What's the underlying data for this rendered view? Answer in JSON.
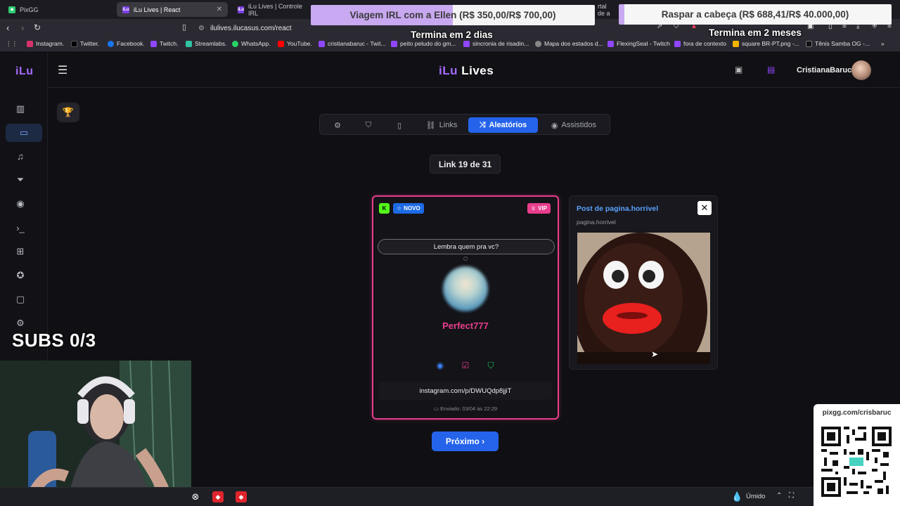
{
  "browser": {
    "tabs": [
      {
        "label": "PixGG",
        "active": false
      },
      {
        "label": "iLu Lives | React",
        "active": true
      },
      {
        "label": "iLu Lives | Controle IRL",
        "active": false
      },
      {
        "label": "rtal de a",
        "active": false
      }
    ],
    "url": "ilulives.ilucasus.com/react",
    "bookmarks": [
      "Instagram.",
      "Twitter.",
      "Facebook.",
      "Twitch.",
      "Streamlabs.",
      "WhatsApp.",
      "YouTube.",
      "cristianabaruc - Twit...",
      "peito peludo do gm...",
      "sincronia de risadin...",
      "Mapa dos estados d...",
      "FlexingSeal - Twitch",
      "fora de contexto",
      "square BR-PT.png -...",
      "Tênis Samba OG -..."
    ]
  },
  "overlay": {
    "goal1": {
      "title": "Viagem IRL com a Ellen",
      "amount": "(R$ 350,00/R$ 700,00)",
      "progress": 0.5,
      "deadline": "Termina em 2 dias"
    },
    "goal2": {
      "title": "Raspar a cabeça",
      "amount": "(R$ 688,41/R$ 40.000,00)",
      "progress": 0.017,
      "deadline": "Termina em 2 meses"
    },
    "subs": "SUBS 0/3",
    "qr_label": "pixgg.com/crisbaruc"
  },
  "app": {
    "logo_short": "iLu",
    "logo_main_a": "iLu",
    "logo_main_b": " Lives",
    "username": "CristianaBaruc",
    "tabs": [
      {
        "label": "",
        "icon": "gear-icon"
      },
      {
        "label": "",
        "icon": "shield-icon"
      },
      {
        "label": "",
        "icon": "tablet-icon"
      },
      {
        "label": "Links",
        "icon": "link-icon"
      },
      {
        "label": "Aleatórios",
        "icon": "shuffle-icon",
        "active": true
      },
      {
        "label": "Assistidos",
        "icon": "eye-icon"
      }
    ],
    "counter": "Link 19 de 31",
    "card": {
      "badge_new": "NOVO",
      "badge_vip": "VIP",
      "message": "Lembra quem pra vc?",
      "sender": "Perfect777",
      "link": "instagram.com/p/DWUQdp8jjiT",
      "sent": "Enviado: 03/04 às 22:29"
    },
    "preview": {
      "title": "Post de pagina.horrivel",
      "subtitle": "pagina.horrivel"
    },
    "next_label": "Próximo ›"
  },
  "taskbar": {
    "weather": "Úmido"
  },
  "colors": {
    "accent": "#2563eb",
    "pink": "#e83e8c",
    "purple": "#a56bff"
  }
}
